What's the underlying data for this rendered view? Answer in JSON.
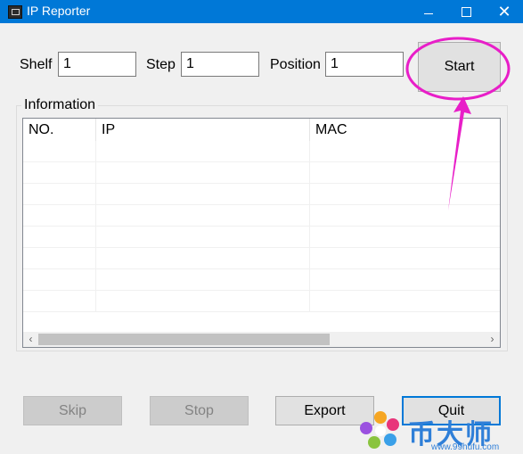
{
  "window": {
    "title": "IP Reporter",
    "minimize_glyph": "",
    "maximize_glyph": "",
    "close_glyph": "✕"
  },
  "form": {
    "shelf": {
      "label": "Shelf",
      "value": "1"
    },
    "step": {
      "label": "Step",
      "value": "1"
    },
    "position": {
      "label": "Position",
      "value": "1"
    }
  },
  "buttons": {
    "start": "Start",
    "skip": "Skip",
    "stop": "Stop",
    "export": "Export",
    "quit": "Quit"
  },
  "info": {
    "group_label": "Information",
    "columns": [
      "NO.",
      "IP",
      "MAC"
    ],
    "rows": [
      [
        "",
        "",
        ""
      ],
      [
        "",
        "",
        ""
      ],
      [
        "",
        "",
        ""
      ],
      [
        "",
        "",
        ""
      ],
      [
        "",
        "",
        ""
      ],
      [
        "",
        "",
        ""
      ],
      [
        "",
        "",
        ""
      ],
      [
        "",
        "",
        ""
      ]
    ],
    "scroll_left_glyph": "‹",
    "scroll_right_glyph": "›"
  },
  "watermark": {
    "brand": "币大师",
    "url": "www.99hufu.com"
  },
  "colors": {
    "titlebar": "#0078d7",
    "annotation": "#e81ec8",
    "watermark": "#2f7fd8"
  }
}
